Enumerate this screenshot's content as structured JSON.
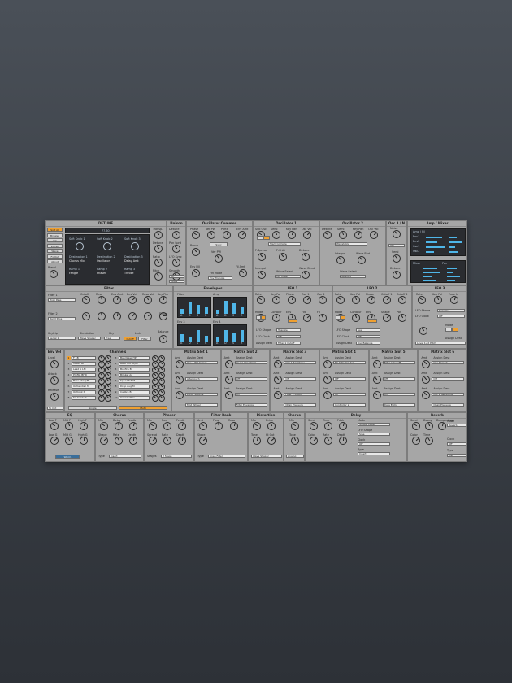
{
  "colors": {
    "background_top": "#4a5058",
    "panel": "#a6a6a6",
    "accent": "#f0a030",
    "display_bar": "#4fb6e8"
  },
  "detune": {
    "title": "DETUNE",
    "presets": [
      "Soft All",
      "Browse",
      "Arp",
      "Voiced",
      "Wave",
      "Fx Out",
      "About"
    ],
    "display_value": "77.60",
    "blend_label": "Blend",
    "knobs": [
      "Soft Knob 1",
      "Soft Knob 2",
      "Soft Knob 3"
    ],
    "destinations": [
      {
        "label": "Destination 1",
        "value": "Chorus Mix"
      },
      {
        "label": "Destination 2",
        "value": "Oscillator"
      },
      {
        "label": "Destination 3",
        "value": "Delay Amt"
      }
    ],
    "ramps": [
      {
        "label": "Ramp 1",
        "value": "Fangle"
      },
      {
        "label": "Ramp 2",
        "value": "Phaser"
      },
      {
        "label": "Ramp 3",
        "value": "Throse"
      }
    ],
    "right_labels": [
      "Transp.",
      "Detune",
      "Ratio",
      "Pitch"
    ]
  },
  "unison": {
    "title": "Unison",
    "labels": [
      "Detune",
      "Pan Sprd",
      "LFO Sync",
      "Smooth"
    ],
    "dropdowns": [
      "On",
      "Mode"
    ]
  },
  "osc_common": {
    "title": "Oscillator Common",
    "knobs": [
      "Phase",
      "Ver PW",
      "Porta",
      "Env Amt"
    ],
    "button": "Sync",
    "labels": [
      "Ver PW",
      "Env Fill",
      "Fil Amt",
      "FM Mode"
    ],
    "dropdown": "Env Triangle",
    "punch": "Punch"
  },
  "osc1": {
    "title": "Oscillator 1",
    "knobs": [
      "Sub Osc",
      "Semi",
      "Key Pan",
      "Osc Vol"
    ],
    "labels": [
      "F-Spread",
      "F-Shift",
      "Detune",
      "Interpol",
      "Wave Select",
      "Wave Bend"
    ],
    "dropdowns": [
      "Slam Compile",
      "Mc Tmeb"
    ]
  },
  "osc2": {
    "title": "Oscillator 2",
    "knobs": [
      "Detune",
      "Semi",
      "Key Pan",
      "Osc Vol"
    ],
    "labels": [
      "Interpol",
      "Wave Bnd",
      "Wave Select"
    ],
    "dropdowns": [
      "Wavetable",
      "Sawtd 2"
    ]
  },
  "osc3": {
    "title": "Osc 3 / N",
    "labels": [
      "Noise",
      "Semi",
      "Detune"
    ],
    "dropdown": "Off"
  },
  "amp_mixer": {
    "title": "Amp / Mixer",
    "sub_title": "Amp / Fil",
    "rows": [
      "Env1",
      "Env2",
      "Osc1",
      "Osc2"
    ],
    "mixer": "Mixer",
    "pan": "Pan"
  },
  "filter": {
    "title": "Filter",
    "knobs": [
      "Cutoff",
      "Reso",
      "Env Amt",
      "Env Vel",
      "Reso Vel",
      "Key Flw"
    ],
    "labels": [
      "Filter 1",
      "Filter 2",
      "Keytrip",
      "Simulation",
      "Key",
      "Link",
      "Balance",
      "Drive"
    ],
    "dropdowns": [
      "High Pass",
      "Band Pass",
      "Serial 1",
      "Wave Shaper",
      "Free"
    ],
    "buttons": [
      "Cutoff",
      "Filter"
    ]
  },
  "envelopes": {
    "title": "Envelopes",
    "labels": [
      "Filter",
      "Amp",
      "Env 3",
      "Env 4"
    ],
    "letters": [
      "A",
      "D",
      "S",
      "R"
    ],
    "levels": {
      "filter": [
        0.35,
        0.85,
        0.6,
        0.45
      ],
      "amp": [
        0.3,
        0.9,
        0.7,
        0.5
      ],
      "env3": [
        0.5,
        0.35,
        0.75,
        0.4
      ],
      "env4": [
        0.3,
        0.75,
        0.55,
        0.8
      ]
    }
  },
  "lfo1": {
    "title": "LFO 1",
    "knobs": [
      "Rate",
      "Key Fol",
      "Phase",
      "Osc 1",
      "Osc 2"
    ],
    "labels": [
      "Mode",
      "Contour",
      "Env",
      "Filt",
      "Fx"
    ],
    "dropdowns": [
      "Triangle",
      "Off",
      "Filter 1 Cutoff"
    ],
    "row_labels": [
      "LFO Shape",
      "LFO Clock",
      "Assign Dest"
    ]
  },
  "lfo2": {
    "title": "LFO 2",
    "knobs": [
      "Rate",
      "Key Fol",
      "Phase",
      "Cutoff 1",
      "Cutoff 2"
    ],
    "labels": [
      "Mode",
      "Contour",
      "Env",
      "Shape",
      "Pan"
    ],
    "dropdowns": [
      "Saw",
      "Off",
      "Osc Balance"
    ],
    "row_labels": [
      "LFO Shape",
      "LFO Clock",
      "Assign Dest"
    ]
  },
  "lfo3": {
    "title": "LFO 3",
    "knobs": [
      "Rate",
      "Key Fol",
      "Fade In"
    ],
    "labels": [
      "LFO Shape",
      "LFO Clock",
      "Mode",
      "Assign Dest"
    ],
    "dropdowns": [
      "Triangle",
      "Off",
      "Level 1+2 Pitch"
    ]
  },
  "env_vel": {
    "title": "Env Vel",
    "labels": [
      "Level",
      "Attack",
      "Release"
    ],
    "dropdown": "To Cnt"
  },
  "channels": {
    "title": "Channels",
    "rows": [
      [
        "1",
        "F 1B",
        "3",
        "Bandpass HP"
      ],
      [
        "2",
        "Mixed Ml",
        "4",
        "Barb Urb ArpB"
      ],
      [
        "3",
        "Lead A LM",
        "5",
        "Bonfire Bl"
      ],
      [
        "4",
        "Profile BHD",
        "6",
        "Brisket Ad"
      ],
      [
        "5",
        "Bass SharpM",
        "7",
        "SpeedFall M"
      ],
      [
        "6",
        "Outlandish M",
        "8",
        "Drop Aug M"
      ],
      [
        "7",
        "Outlook M",
        "9",
        "Calibre B"
      ],
      [
        "8",
        "Sn Gunk Id",
        "10",
        "Caveat Stor"
      ]
    ],
    "buttons": [
      "Single",
      "Multi"
    ]
  },
  "matrix": [
    {
      "title": "Matrix Slot 1",
      "dests": [
        "Osc 1 PW Select",
        "Patch Volume",
        "Mod Wheel"
      ],
      "src": "Aftertouch"
    },
    {
      "title": "Matrix Slot 2",
      "dests": [
        "Osc 1 Waveform",
        "Off",
        "Filter Envelope"
      ],
      "src": "Off"
    },
    {
      "title": "Matrix Slot 3",
      "dests": [
        "Osc 1 Semitone",
        "Filter 1 Cutoff",
        "Chan Pressure"
      ],
      "src": "Off"
    },
    {
      "title": "Matrix Slot 4",
      "dests": [
        "FX 3 Dodge Arp",
        "Off",
        "Controller 2"
      ],
      "src": "Off"
    },
    {
      "title": "Matrix Slot 5",
      "dests": [
        "Filter 1 Cutoff",
        "Off",
        "Data Entry"
      ],
      "src": "Off"
    },
    {
      "title": "Matrix Slot 6",
      "dests": [
        "Osc Spread",
        "Osc 2 Semitone",
        "Chan Pressure"
      ],
      "src": "Off"
    }
  ],
  "matrix_labels": [
    "Amt",
    "Assign Dest",
    "Amt",
    "Assign Dest",
    "Amt",
    "Assign Dest"
  ],
  "eq": {
    "title": "EQ",
    "knobs": [
      "Low F",
      "Mid F",
      "High F",
      "Low G",
      "Mid G",
      "High G"
    ],
    "tag": "Warm"
  },
  "chorus1": {
    "title": "Chorus",
    "knobs": [
      "Mix",
      "Delay",
      "Feedb",
      "Shape",
      "Rate",
      "Depth"
    ],
    "type_label": "Type",
    "dropdown": "Insert"
  },
  "phaser": {
    "title": "Phaser",
    "knobs": [
      "Mix",
      "Freq",
      "Feedb",
      "Spread",
      "Rate",
      "Depth"
    ],
    "label": "Stages",
    "dropdown": "2 Stage"
  },
  "filter_bank": {
    "title": "Filter Bank",
    "knobs": [
      "Amt",
      "Freq",
      "Reso",
      "Slope"
    ],
    "type_label": "Type",
    "dropdown": "Knee Filter"
  },
  "distortion": {
    "title": "Distortion",
    "knobs": [
      "Mix",
      "Drive",
      "Tone",
      "Hi Cut"
    ],
    "dropdown": "Wave Shaper"
  },
  "chorus2": {
    "title": "Chorus",
    "knobs": [
      "Mix",
      "Tone"
    ],
    "dropdown": "Analog"
  },
  "delay": {
    "title": "Delay",
    "knobs": [
      "Send",
      "Time",
      "Fdbk",
      "Color",
      "Rate",
      "Depth"
    ],
    "labels": [
      "Mode",
      "LFO Shape",
      "Clock",
      "Type"
    ],
    "dropdowns": [
      "Simple Delay",
      "Sine",
      "Off",
      "Insert"
    ]
  },
  "reverb": {
    "title": "Reverb",
    "knobs": [
      "Send",
      "Decay",
      "Dampening",
      "Color",
      "Time"
    ],
    "labels": [
      "Mode",
      "Clock",
      "Type"
    ],
    "dropdowns": [
      "Reverb",
      "Off",
      "Hall"
    ]
  }
}
